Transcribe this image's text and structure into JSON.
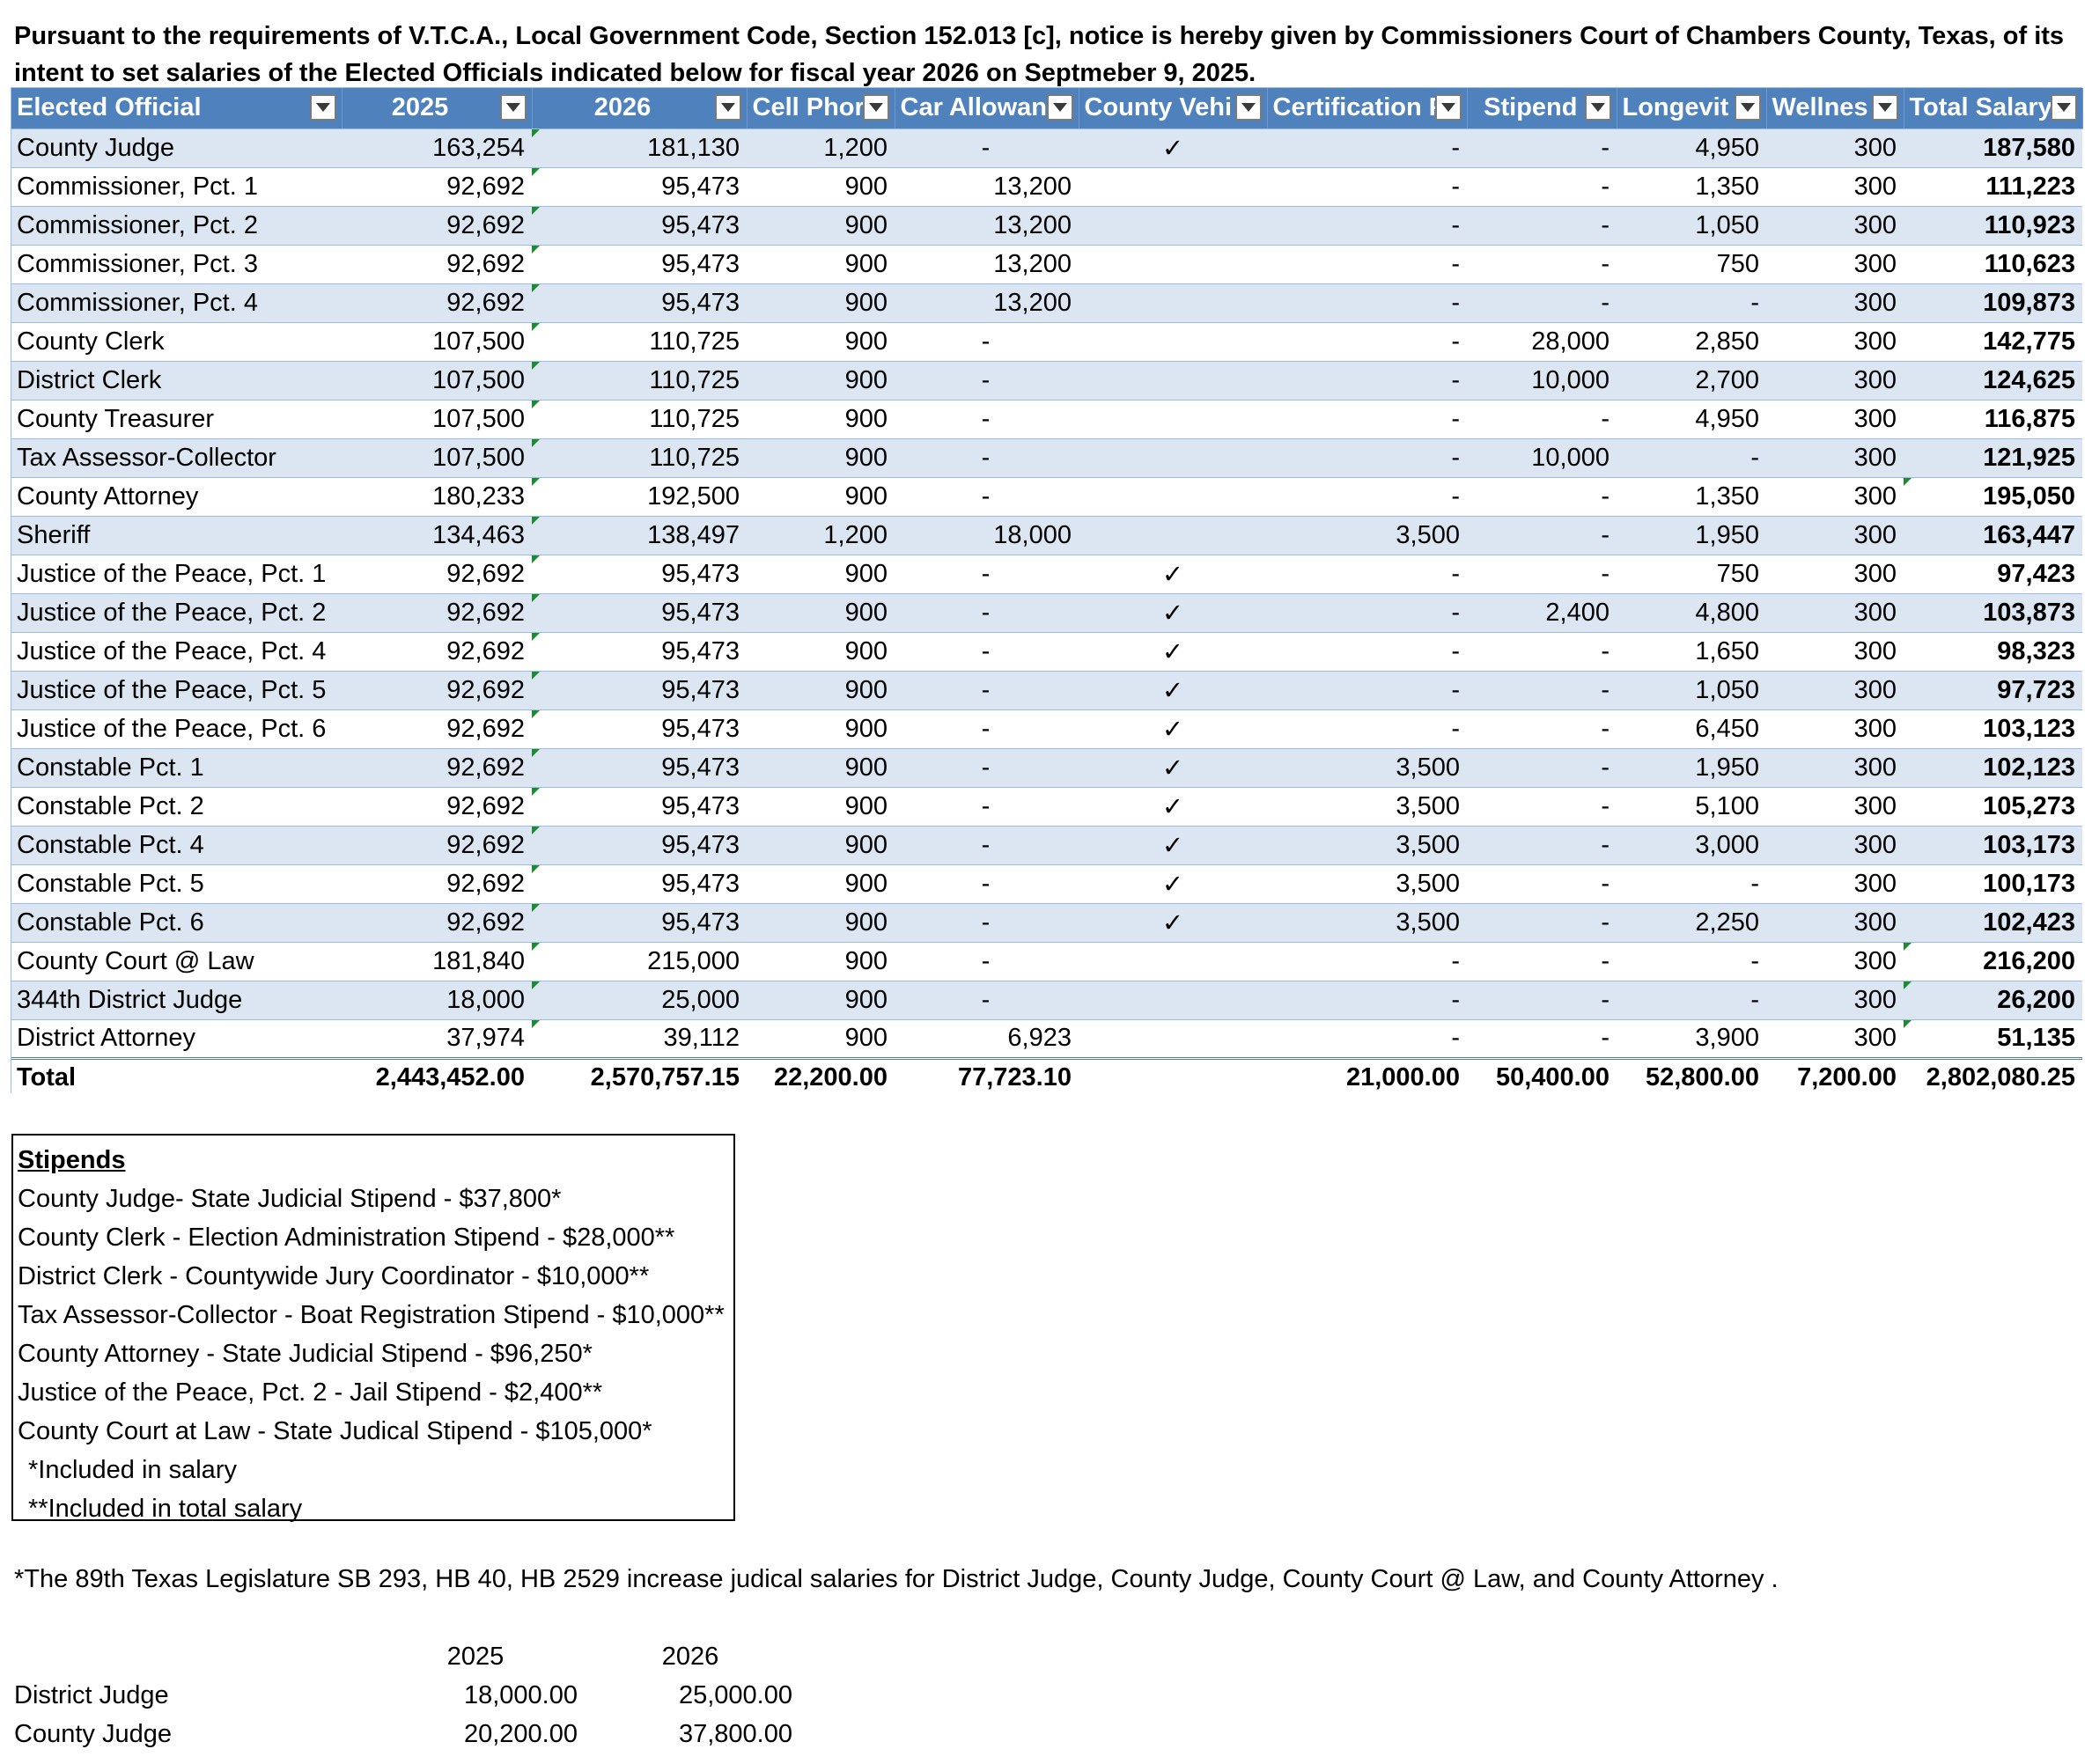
{
  "notice": "Pursuant to the requirements of V.T.C.A., Local Government Code, Section 152.013 [c], notice is hereby given by Commissioners Court of Chambers County, Texas, of its intent to set salaries of the Elected Officials indicated below for fiscal year 2026 on Septmeber 9, 2025.",
  "table": {
    "headers": [
      "Elected Official",
      "2025",
      "2026",
      "Cell Phor",
      "Car Allowan",
      "County Vehi",
      "Certification Pa",
      "Stipend",
      "Longevit",
      "Wellnes",
      "Total Salary"
    ],
    "rows": [
      [
        "County Judge",
        "163,254",
        "181,130",
        "1,200",
        "-",
        "✓",
        "-",
        "-",
        "4,950",
        "300",
        "187,580"
      ],
      [
        "Commissioner, Pct. 1",
        "92,692",
        "95,473",
        "900",
        "13,200",
        "",
        "-",
        "-",
        "1,350",
        "300",
        "111,223"
      ],
      [
        "Commissioner, Pct. 2",
        "92,692",
        "95,473",
        "900",
        "13,200",
        "",
        "-",
        "-",
        "1,050",
        "300",
        "110,923"
      ],
      [
        "Commissioner, Pct. 3",
        "92,692",
        "95,473",
        "900",
        "13,200",
        "",
        "-",
        "-",
        "750",
        "300",
        "110,623"
      ],
      [
        "Commissioner, Pct. 4",
        "92,692",
        "95,473",
        "900",
        "13,200",
        "",
        "-",
        "-",
        "-",
        "300",
        "109,873"
      ],
      [
        "County Clerk",
        "107,500",
        "110,725",
        "900",
        "-",
        "",
        "-",
        "28,000",
        "2,850",
        "300",
        "142,775"
      ],
      [
        "District Clerk",
        "107,500",
        "110,725",
        "900",
        "-",
        "",
        "-",
        "10,000",
        "2,700",
        "300",
        "124,625"
      ],
      [
        "County Treasurer",
        "107,500",
        "110,725",
        "900",
        "-",
        "",
        "-",
        "-",
        "4,950",
        "300",
        "116,875"
      ],
      [
        "Tax Assessor-Collector",
        "107,500",
        "110,725",
        "900",
        "-",
        "",
        "-",
        "10,000",
        "-",
        "300",
        "121,925"
      ],
      [
        "County Attorney",
        "180,233",
        "192,500",
        "900",
        "-",
        "",
        "-",
        "-",
        "1,350",
        "300",
        "195,050"
      ],
      [
        "Sheriff",
        "134,463",
        "138,497",
        "1,200",
        "18,000",
        "",
        "3,500",
        "-",
        "1,950",
        "300",
        "163,447"
      ],
      [
        "Justice of the Peace, Pct. 1",
        "92,692",
        "95,473",
        "900",
        "-",
        "✓",
        "-",
        "-",
        "750",
        "300",
        "97,423"
      ],
      [
        "Justice of the Peace, Pct. 2",
        "92,692",
        "95,473",
        "900",
        "-",
        "✓",
        "-",
        "2,400",
        "4,800",
        "300",
        "103,873"
      ],
      [
        "Justice of the Peace, Pct. 4",
        "92,692",
        "95,473",
        "900",
        "-",
        "✓",
        "-",
        "-",
        "1,650",
        "300",
        "98,323"
      ],
      [
        "Justice of the Peace, Pct. 5",
        "92,692",
        "95,473",
        "900",
        "-",
        "✓",
        "-",
        "-",
        "1,050",
        "300",
        "97,723"
      ],
      [
        "Justice of the Peace, Pct. 6",
        "92,692",
        "95,473",
        "900",
        "-",
        "✓",
        "-",
        "-",
        "6,450",
        "300",
        "103,123"
      ],
      [
        "Constable Pct. 1",
        "92,692",
        "95,473",
        "900",
        "-",
        "✓",
        "3,500",
        "-",
        "1,950",
        "300",
        "102,123"
      ],
      [
        "Constable Pct. 2",
        "92,692",
        "95,473",
        "900",
        "-",
        "✓",
        "3,500",
        "-",
        "5,100",
        "300",
        "105,273"
      ],
      [
        "Constable Pct. 4",
        "92,692",
        "95,473",
        "900",
        "-",
        "✓",
        "3,500",
        "-",
        "3,000",
        "300",
        "103,173"
      ],
      [
        "Constable Pct. 5",
        "92,692",
        "95,473",
        "900",
        "-",
        "✓",
        "3,500",
        "-",
        "-",
        "300",
        "100,173"
      ],
      [
        "Constable Pct. 6",
        "92,692",
        "95,473",
        "900",
        "-",
        "✓",
        "3,500",
        "-",
        "2,250",
        "300",
        "102,423"
      ],
      [
        "County Court @ Law",
        "181,840",
        "215,000",
        "900",
        "-",
        "",
        "-",
        "-",
        "-",
        "300",
        "216,200"
      ],
      [
        "344th District Judge",
        "18,000",
        "25,000",
        "900",
        "-",
        "",
        "-",
        "-",
        "-",
        "300",
        "26,200"
      ],
      [
        "District Attorney",
        "37,974",
        "39,112",
        "900",
        "6,923",
        "",
        "-",
        "-",
        "3,900",
        "300",
        "51,135"
      ]
    ],
    "total": [
      "Total",
      "2,443,452.00",
      "2,570,757.15",
      "22,200.00",
      "77,723.10",
      "",
      "21,000.00",
      "50,400.00",
      "52,800.00",
      "7,200.00",
      "2,802,080.25"
    ]
  },
  "stipends": {
    "heading": "Stipends",
    "items": [
      "County Judge- State Judicial Stipend - $37,800*",
      "County Clerk - Election Administration Stipend - $28,000**",
      "District Clerk - Countywide Jury Coordinator - $10,000**",
      "Tax Assessor-Collector - Boat Registration Stipend - $10,000**",
      "County Attorney - State Judicial Stipend - $96,250*",
      "Justice of the Peace, Pct. 2 - Jail Stipend - $2,400**",
      "County Court at Law - State Judical Stipend - $105,000*"
    ],
    "notes": [
      "*Included in salary",
      "**Included in total salary"
    ]
  },
  "footnote": "*The 89th Texas Legislature SB 293, HB 40, HB 2529 increase judical salaries for District Judge, County Judge, County Court @ Law, and County Attorney .",
  "judicial": {
    "headers": [
      "",
      "2025",
      "2026"
    ],
    "rows": [
      [
        "District Judge",
        "18,000.00",
        "25,000.00"
      ],
      [
        "County Judge",
        "20,200.00",
        "37,800.00"
      ]
    ]
  },
  "icons": {
    "filter": "dropdown-arrow-icon",
    "check": "checkmark-icon"
  },
  "colors": {
    "header": "#4f81bd",
    "band": "#dce6f2",
    "marker": "#1e8c2e"
  }
}
